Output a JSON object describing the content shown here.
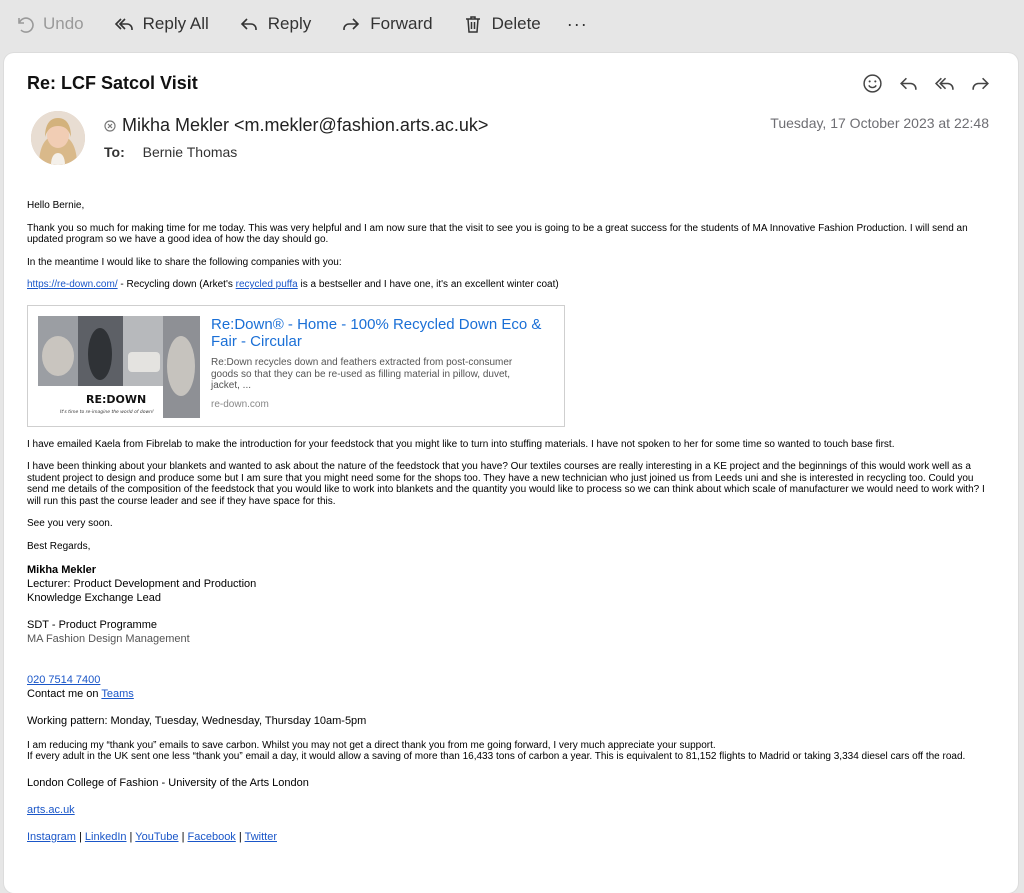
{
  "toolbar": {
    "undo": "Undo",
    "reply_all": "Reply All",
    "reply": "Reply",
    "forward": "Forward",
    "delete": "Delete",
    "more": "···"
  },
  "message": {
    "subject": "Re: LCF Satcol Visit",
    "sender": "Mikha Mekler <m.mekler@fashion.arts.ac.uk>",
    "to_label": "To:",
    "to": "Bernie Thomas",
    "date": "Tuesday, 17 October 2023 at 22:48"
  },
  "body": {
    "greeting": "Hello Bernie,",
    "p1": "Thank you so much for making time for me today. This was very helpful and I am now sure that the visit to see you is going to be a great success for the students of MA Innovative Fashion Production. I will send an updated program so we have a good idea of how the day should go.",
    "p2": "In the meantime I would like to share the following companies with you:",
    "link1": "https://re-down.com/",
    "p3_a": " - Recycling down (Arket's ",
    "link2": "recycled puffa",
    "p3_b": " is a bestseller and I have one, it's an excellent winter coat)",
    "p4": "I have emailed Kaela from Fibrelab to make the introduction for your feedstock that you might like to turn into stuffing materials. I have not spoken to her for some time so wanted to touch base first.",
    "p5": "I have been thinking about your blankets and wanted to ask about the nature of the feedstock that you have? Our textiles courses are really interesting in a KE project and the beginnings of this would work well as a student project to design and produce some but I am sure that you might need some for the shops too. They have a new technician who just joined us from Leeds uni and she is interested in recycling too. Could you send me details of the composition of the feedstock that you would like to work into blankets and the quantity you would like to process so we can think about which scale of manufacturer we would need to work with? I will run this past the course leader and see if they have space for this.",
    "p6": "See you very soon.",
    "p7": "Best Regards,"
  },
  "preview": {
    "title": "Re:Down® - Home - 100% Recycled Down Eco & Fair - Circular",
    "description": "Re:Down recycles down and feathers extracted from post-consumer goods so that they can be re-used as filling material in pillow, duvet, jacket, ...",
    "domain": "re-down.com",
    "logo_text": "RE:DOWN",
    "logo_tagline": "It's time to re-imagine the world of down!"
  },
  "signature": {
    "name": "Mikha Mekler",
    "title": "Lecturer: Product Development and Production",
    "role": "Knowledge Exchange Lead",
    "programme": "SDT - Product Programme",
    "course": "MA Fashion Design Management",
    "phone": "020 7514 7400",
    "contact_prefix": "Contact me on ",
    "teams": "Teams",
    "working_pattern": "Working pattern: Monday, Tuesday, Wednesday, Thursday 10am-5pm",
    "carbon1": "I am reducing my “thank you” emails to save carbon. Whilst you may not get a direct thank you from me going forward, I very much appreciate your support.",
    "carbon2": "If every adult in the UK sent one less “thank you” email a day, it would allow a saving of more than 16,433 tons of carbon a year. This is equivalent to 81,152 flights to Madrid or taking 3,334 diesel cars off the road.",
    "college": "London College of Fashion - University of the Arts London",
    "website": "arts.ac.uk",
    "social": [
      "Instagram",
      "LinkedIn",
      "YouTube",
      "Facebook",
      "Twitter"
    ],
    "separator": " | "
  }
}
